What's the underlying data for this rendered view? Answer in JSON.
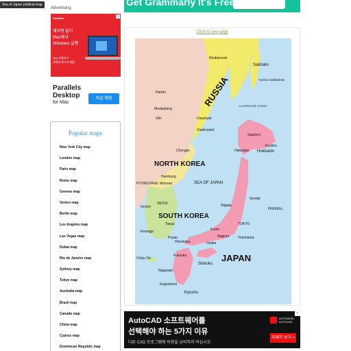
{
  "tooltip": "Sea of Japan political map",
  "advertising_label": "Advertising",
  "ad_parallels": {
    "brand_small": "Parallels",
    "headline": [
      "재부팅 없이",
      "Mac에서",
      "Windows 실행"
    ],
    "subline": [
      "Mac 사용자가",
      "선택한 최고의 제품"
    ],
    "brand_big": [
      "Parallels",
      "Desktop"
    ],
    "brand_sub": "for Mac",
    "cta": "지금 체험",
    "close": "x"
  },
  "ad_grammarly": {
    "text": "Get Grammarly It's Free"
  },
  "popular_maps": {
    "title": "Popular maps",
    "items": [
      "New York City map",
      "London map",
      "Paris map",
      "Rome map",
      "Geneva map",
      "Venice map",
      "Berlin map",
      "Los Angeles map",
      "Las Vegas map",
      "Dubai map",
      "Rio de Janeiro map",
      "Sydney map",
      "Tokyo map",
      "Australia map",
      "Brazil map",
      "Canada map",
      "China map",
      "Cyprus map",
      "Dominican Republic map"
    ]
  },
  "map_panel": {
    "click_link": "Click to see large",
    "labels": {
      "russia": "RUSSIA",
      "north_korea": "NORTH KOREA",
      "south_korea": "SOUTH KOREA",
      "japan": "JAPAN",
      "sea_of_japan": "SEA OF JAPAN",
      "la_perouse": "LA PEROUSE STRAIT",
      "khabarovsk": "Khabarovsk",
      "sakhalin": "Sakhalin",
      "yuzhno": "Yuzhno Sakhalinsk",
      "sapporo": "Sapporo",
      "kushiro": "Kushiro",
      "hokkaido": "Hokkaido",
      "hakodate": "Hakodate",
      "vladivostok": "Vladivostok",
      "ussuriysk": "Ussuriysk",
      "harbin": "Harbin",
      "jilin": "Jilin",
      "mudanjiang": "Mudanjiang",
      "chongjin": "Chongjin",
      "pyongyang": "PYONGYANG",
      "wonsan": "Wonsan",
      "hamhung": "Hamhung",
      "seoul": "SEOUL",
      "inchon": "Inchon",
      "taegu": "Taegu",
      "pusan": "Pusan",
      "kwangju": "Kwangju",
      "cheju": "Cheju Do",
      "sendai": "Sendai",
      "honshu": "Honshu",
      "niigata": "Niigata",
      "tokyo": "TOKYO",
      "yokohama": "Yokohama",
      "nagoya": "Nagoya",
      "kyoto": "Kyoto",
      "osaka": "Osaka",
      "hiroshima": "Hiroshima",
      "shikoku": "Shikoku",
      "kyushu": "Kyushu",
      "fukuoka": "Fukuoka",
      "nagasaki": "Nagasaki",
      "kagoshima": "Kagoshima"
    }
  },
  "ad_autocad": {
    "line1": "AutoCAD 소프트웨어를",
    "line2": "선택해야 하는 5가지 이유",
    "line3": "다른 CAD 프로그램에 비용을 낭비하지 마십시오",
    "logo_text": [
      "AUTODESK",
      "AUTOCAD"
    ],
    "cta": "자세히 보기 >",
    "close": "x"
  },
  "colors": {
    "sea": "#bfe1f3",
    "russia": "#f2ea6b",
    "china": "#f4d3c7",
    "north_korea": "#f5e79a",
    "south_korea": "#c9e39a",
    "japan": "#f39bb3",
    "link_green": "#6ab023",
    "popular_blue": "#3d8fd6",
    "ad_red": "#e5262f",
    "grammarly_green": "#15c39a"
  }
}
